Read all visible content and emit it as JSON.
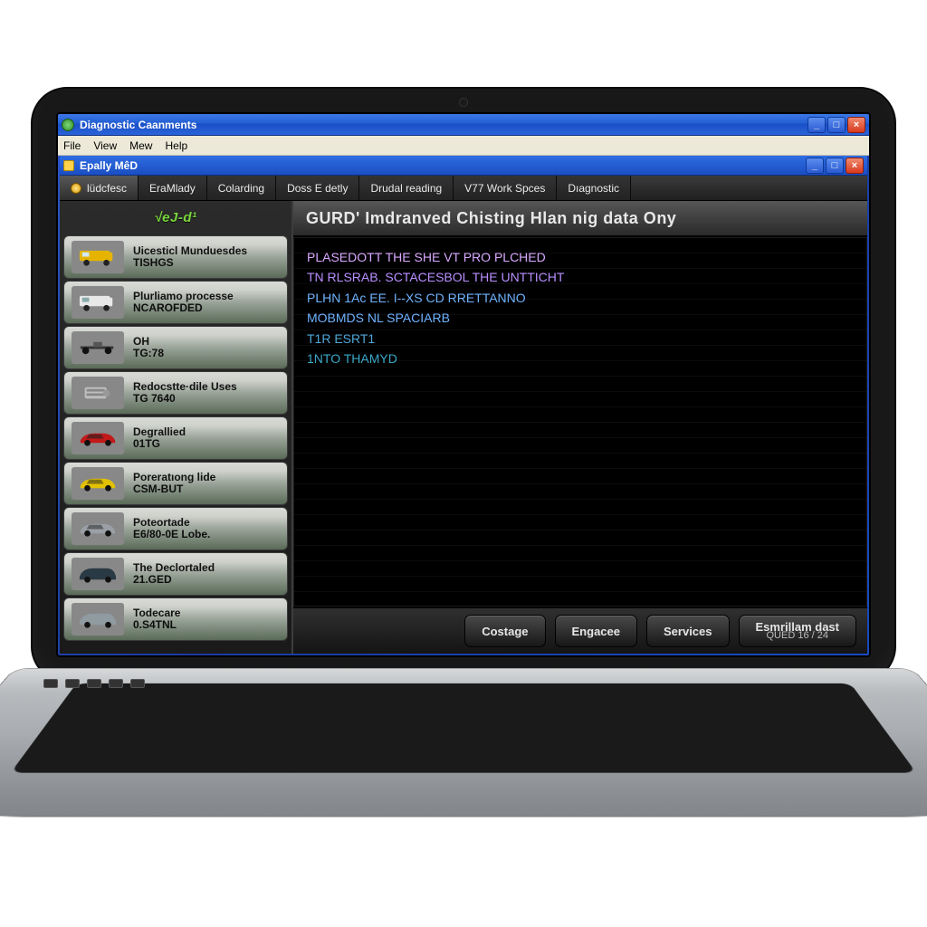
{
  "outer_window": {
    "title": "Diagnostic Caanments",
    "minimize": "_",
    "maximize": "□",
    "close": "×"
  },
  "menubar": {
    "file": "File",
    "view": "View",
    "mew": "Mew",
    "help": "Help"
  },
  "child_window": {
    "title": "Epally MêD",
    "minimize": "_",
    "maximize": "□",
    "close": "×"
  },
  "tabs": {
    "t0": "lüdcfesc",
    "t1": "EraMlady",
    "t2": "Colarding",
    "t3": "Doss E detly",
    "t4": "Drudal reading",
    "t5": "V77 Work Spces",
    "t6": "Dıagnostic"
  },
  "brand": "√eJ-d¹",
  "sidebar": {
    "items": [
      {
        "label": "Uicesticl Munduesdes",
        "code": "TISHGS",
        "vehicle": "van-yellow"
      },
      {
        "label": "Plurliamo processe",
        "code": "NCAROFDED",
        "vehicle": "van-white"
      },
      {
        "label": "OH",
        "code": "TG:78",
        "vehicle": "chassis"
      },
      {
        "label": "Redocstte·dile Uses",
        "code": "TG 7640",
        "vehicle": "engine"
      },
      {
        "label": "Degrallied",
        "code": "01TG",
        "vehicle": "sedan-red"
      },
      {
        "label": "Poreratıong lide",
        "code": "CSM-BUT",
        "vehicle": "sedan-yellow"
      },
      {
        "label": "Poteortade",
        "code": "E6/80-0E Lobe.",
        "vehicle": "sedan-grey"
      },
      {
        "label": "The Declortaled",
        "code": "21.GED",
        "vehicle": "suv-dark"
      },
      {
        "label": "Todecare",
        "code": "0.S4TNL",
        "vehicle": "suv-grey"
      }
    ]
  },
  "main_header": "GURD' Imdranved Chisting Hlan nig data Ony",
  "terminal": {
    "l1": "PLASEDOTT  THE SHE VT  PRO  PLCHED",
    "l2": "TN  RLSRAB.  SCTACESBOL  THE UNTTICHT",
    "l3": "PLHN 1Ac  EE. I--XS  CD  RRETTANNO",
    "l4": "MOBMDS NL  SPACIARB",
    "l5": "T1R ESRT1",
    "l6": "1NTO THAMYD"
  },
  "footer": {
    "b1": "Costage",
    "b2": "Engacee",
    "b3": "Services",
    "b4_line1": "Esmrillam dast",
    "b4_line2": "QUED 16 / 24"
  }
}
